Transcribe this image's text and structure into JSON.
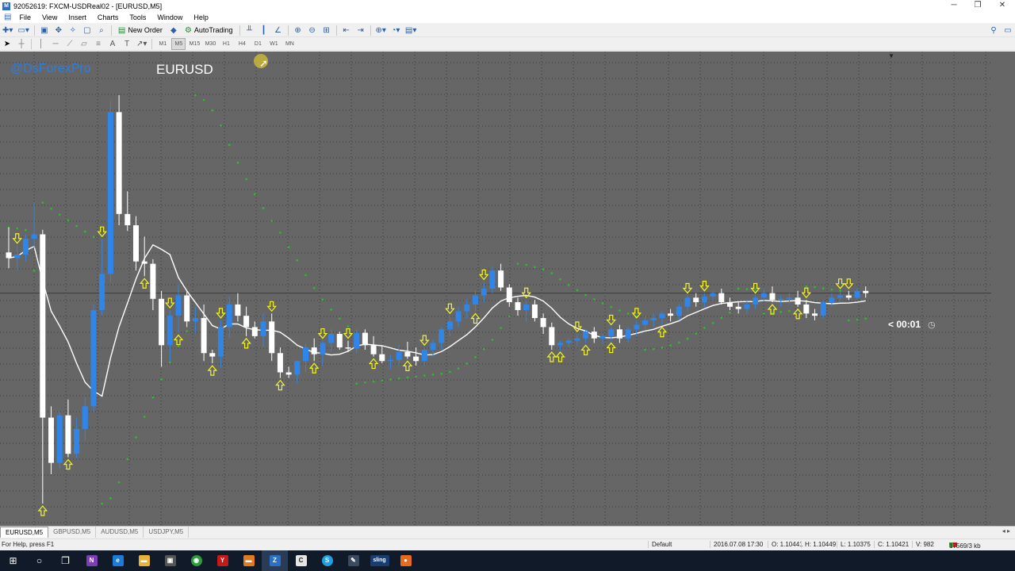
{
  "window": {
    "title": "92052619: FXCM-USDReal02 - [EURUSD,M5]",
    "controls": [
      "─",
      "❐",
      "✕"
    ]
  },
  "menu": [
    "File",
    "View",
    "Insert",
    "Charts",
    "Tools",
    "Window",
    "Help"
  ],
  "toolbar": {
    "new_order": "New Order",
    "autotrading": "AutoTrading"
  },
  "timeframes": [
    "M1",
    "M5",
    "M15",
    "M30",
    "H1",
    "H4",
    "D1",
    "W1",
    "MN"
  ],
  "chart": {
    "watermark": "@DsForexPro",
    "symbol_label": "EURUSD",
    "timer": "< 00:01",
    "bull_color": "#2f86e8",
    "bear_color": "#ffffff",
    "arrow_color": "#f5f51e",
    "sar_color": "#27c227",
    "ma_color": "#ffffff",
    "background": "#666666"
  },
  "chart_data": {
    "type": "candlestick",
    "symbol": "EURUSD",
    "timeframe": "M5",
    "candles": [
      {
        "o": 1.10446,
        "h": 1.10468,
        "l": 1.10432,
        "c": 1.10441
      },
      {
        "o": 1.10441,
        "h": 1.10452,
        "l": 1.1043,
        "c": 1.10444
      },
      {
        "o": 1.10444,
        "h": 1.10462,
        "l": 1.10438,
        "c": 1.10458
      },
      {
        "o": 1.10458,
        "h": 1.1049,
        "l": 1.1045,
        "c": 1.10462
      },
      {
        "o": 1.10462,
        "h": 1.10466,
        "l": 1.10224,
        "c": 1.103
      },
      {
        "o": 1.103,
        "h": 1.1031,
        "l": 1.1025,
        "c": 1.1026
      },
      {
        "o": 1.1026,
        "h": 1.10305,
        "l": 1.10255,
        "c": 1.10302
      },
      {
        "o": 1.10302,
        "h": 1.10316,
        "l": 1.10265,
        "c": 1.10268
      },
      {
        "o": 1.10268,
        "h": 1.103,
        "l": 1.10264,
        "c": 1.1029
      },
      {
        "o": 1.1029,
        "h": 1.10318,
        "l": 1.1028,
        "c": 1.1031
      },
      {
        "o": 1.1031,
        "h": 1.104,
        "l": 1.10305,
        "c": 1.10395
      },
      {
        "o": 1.10395,
        "h": 1.10458,
        "l": 1.1039,
        "c": 1.10427
      },
      {
        "o": 1.10427,
        "h": 1.1058,
        "l": 1.1042,
        "c": 1.1057
      },
      {
        "o": 1.1057,
        "h": 1.10585,
        "l": 1.1047,
        "c": 1.1048
      },
      {
        "o": 1.1048,
        "h": 1.105,
        "l": 1.10465,
        "c": 1.1047
      },
      {
        "o": 1.1047,
        "h": 1.10478,
        "l": 1.1043,
        "c": 1.10438
      },
      {
        "o": 1.10438,
        "h": 1.1046,
        "l": 1.10425,
        "c": 1.10436
      },
      {
        "o": 1.10436,
        "h": 1.1044,
        "l": 1.10395,
        "c": 1.10405
      },
      {
        "o": 1.10405,
        "h": 1.10412,
        "l": 1.10345,
        "c": 1.10364
      },
      {
        "o": 1.10364,
        "h": 1.10395,
        "l": 1.1035,
        "c": 1.1039
      },
      {
        "o": 1.1039,
        "h": 1.10418,
        "l": 1.10375,
        "c": 1.10408
      },
      {
        "o": 1.10408,
        "h": 1.10412,
        "l": 1.1038,
        "c": 1.10385
      },
      {
        "o": 1.10385,
        "h": 1.10398,
        "l": 1.10375,
        "c": 1.10388
      },
      {
        "o": 1.10388,
        "h": 1.104,
        "l": 1.1035,
        "c": 1.10357
      },
      {
        "o": 1.10357,
        "h": 1.1036,
        "l": 1.10348,
        "c": 1.10354
      },
      {
        "o": 1.10354,
        "h": 1.10386,
        "l": 1.10344,
        "c": 1.1038
      },
      {
        "o": 1.1038,
        "h": 1.10407,
        "l": 1.1037,
        "c": 1.104
      },
      {
        "o": 1.104,
        "h": 1.1041,
        "l": 1.10385,
        "c": 1.1039
      },
      {
        "o": 1.1039,
        "h": 1.10398,
        "l": 1.10372,
        "c": 1.1038
      },
      {
        "o": 1.1038,
        "h": 1.10385,
        "l": 1.1037,
        "c": 1.10372
      },
      {
        "o": 1.10372,
        "h": 1.10392,
        "l": 1.10362,
        "c": 1.10385
      },
      {
        "o": 1.10385,
        "h": 1.10392,
        "l": 1.1035,
        "c": 1.10357
      },
      {
        "o": 1.10357,
        "h": 1.10362,
        "l": 1.10335,
        "c": 1.1034
      },
      {
        "o": 1.1034,
        "h": 1.10345,
        "l": 1.10335,
        "c": 1.10338
      },
      {
        "o": 1.10338,
        "h": 1.1035,
        "l": 1.1033,
        "c": 1.1035
      },
      {
        "o": 1.1035,
        "h": 1.10365,
        "l": 1.1034,
        "c": 1.10362
      },
      {
        "o": 1.10362,
        "h": 1.1037,
        "l": 1.1035,
        "c": 1.10356
      },
      {
        "o": 1.10356,
        "h": 1.10368,
        "l": 1.10346,
        "c": 1.10366
      },
      {
        "o": 1.10366,
        "h": 1.10378,
        "l": 1.10358,
        "c": 1.10374
      },
      {
        "o": 1.10374,
        "h": 1.10376,
        "l": 1.1036,
        "c": 1.10362
      },
      {
        "o": 1.10362,
        "h": 1.10368,
        "l": 1.10358,
        "c": 1.10361
      },
      {
        "o": 1.10361,
        "h": 1.10378,
        "l": 1.10357,
        "c": 1.10375
      },
      {
        "o": 1.10375,
        "h": 1.10378,
        "l": 1.1036,
        "c": 1.10364
      },
      {
        "o": 1.10364,
        "h": 1.10372,
        "l": 1.10354,
        "c": 1.10356
      },
      {
        "o": 1.10356,
        "h": 1.10363,
        "l": 1.10348,
        "c": 1.1035
      },
      {
        "o": 1.1035,
        "h": 1.10356,
        "l": 1.10343,
        "c": 1.10351
      },
      {
        "o": 1.10351,
        "h": 1.10364,
        "l": 1.10346,
        "c": 1.10358
      },
      {
        "o": 1.10358,
        "h": 1.10367,
        "l": 1.10352,
        "c": 1.10354
      },
      {
        "o": 1.10354,
        "h": 1.10362,
        "l": 1.10346,
        "c": 1.1035
      },
      {
        "o": 1.1035,
        "h": 1.10362,
        "l": 1.10346,
        "c": 1.1036
      },
      {
        "o": 1.1036,
        "h": 1.10369,
        "l": 1.10354,
        "c": 1.10366
      },
      {
        "o": 1.10366,
        "h": 1.1038,
        "l": 1.1036,
        "c": 1.10378
      },
      {
        "o": 1.10378,
        "h": 1.1039,
        "l": 1.10372,
        "c": 1.10385
      },
      {
        "o": 1.10385,
        "h": 1.10398,
        "l": 1.1038,
        "c": 1.10394
      },
      {
        "o": 1.10394,
        "h": 1.10405,
        "l": 1.10388,
        "c": 1.104
      },
      {
        "o": 1.104,
        "h": 1.10412,
        "l": 1.10394,
        "c": 1.10408
      },
      {
        "o": 1.10408,
        "h": 1.1042,
        "l": 1.10402,
        "c": 1.10414
      },
      {
        "o": 1.10414,
        "h": 1.10434,
        "l": 1.1041,
        "c": 1.1043
      },
      {
        "o": 1.1043,
        "h": 1.10436,
        "l": 1.10412,
        "c": 1.10415
      },
      {
        "o": 1.10415,
        "h": 1.10418,
        "l": 1.10398,
        "c": 1.10402
      },
      {
        "o": 1.10402,
        "h": 1.10406,
        "l": 1.1039,
        "c": 1.10395
      },
      {
        "o": 1.10395,
        "h": 1.10404,
        "l": 1.10384,
        "c": 1.104
      },
      {
        "o": 1.104,
        "h": 1.10404,
        "l": 1.10385,
        "c": 1.10388
      },
      {
        "o": 1.10388,
        "h": 1.10392,
        "l": 1.10374,
        "c": 1.1038
      },
      {
        "o": 1.1038,
        "h": 1.10384,
        "l": 1.1036,
        "c": 1.10364
      },
      {
        "o": 1.10364,
        "h": 1.10368,
        "l": 1.1036,
        "c": 1.10366
      },
      {
        "o": 1.10366,
        "h": 1.1037,
        "l": 1.10362,
        "c": 1.10368
      },
      {
        "o": 1.10368,
        "h": 1.10374,
        "l": 1.10363,
        "c": 1.1037
      },
      {
        "o": 1.1037,
        "h": 1.10378,
        "l": 1.10366,
        "c": 1.10376
      },
      {
        "o": 1.10376,
        "h": 1.1038,
        "l": 1.10366,
        "c": 1.1037
      },
      {
        "o": 1.1037,
        "h": 1.10374,
        "l": 1.10365,
        "c": 1.10372
      },
      {
        "o": 1.10372,
        "h": 1.1038,
        "l": 1.10368,
        "c": 1.10378
      },
      {
        "o": 1.10378,
        "h": 1.10382,
        "l": 1.10366,
        "c": 1.1037
      },
      {
        "o": 1.1037,
        "h": 1.1038,
        "l": 1.10366,
        "c": 1.10378
      },
      {
        "o": 1.10378,
        "h": 1.10386,
        "l": 1.10372,
        "c": 1.10382
      },
      {
        "o": 1.10382,
        "h": 1.1039,
        "l": 1.10378,
        "c": 1.10386
      },
      {
        "o": 1.10386,
        "h": 1.10392,
        "l": 1.1038,
        "c": 1.10388
      },
      {
        "o": 1.10388,
        "h": 1.10394,
        "l": 1.10382,
        "c": 1.10392
      },
      {
        "o": 1.10392,
        "h": 1.10396,
        "l": 1.10385,
        "c": 1.1039
      },
      {
        "o": 1.1039,
        "h": 1.104,
        "l": 1.10386,
        "c": 1.10398
      },
      {
        "o": 1.10398,
        "h": 1.10408,
        "l": 1.10394,
        "c": 1.10406
      },
      {
        "o": 1.10406,
        "h": 1.1041,
        "l": 1.10398,
        "c": 1.10402
      },
      {
        "o": 1.10402,
        "h": 1.1041,
        "l": 1.10398,
        "c": 1.10407
      },
      {
        "o": 1.10407,
        "h": 1.10412,
        "l": 1.10403,
        "c": 1.1041
      },
      {
        "o": 1.1041,
        "h": 1.10414,
        "l": 1.104,
        "c": 1.10402
      },
      {
        "o": 1.10402,
        "h": 1.10406,
        "l": 1.10395,
        "c": 1.10398
      },
      {
        "o": 1.10398,
        "h": 1.10402,
        "l": 1.10392,
        "c": 1.10396
      },
      {
        "o": 1.10396,
        "h": 1.10404,
        "l": 1.10392,
        "c": 1.104
      },
      {
        "o": 1.104,
        "h": 1.10408,
        "l": 1.10396,
        "c": 1.10406
      },
      {
        "o": 1.10406,
        "h": 1.10414,
        "l": 1.10402,
        "c": 1.1041
      },
      {
        "o": 1.1041,
        "h": 1.10416,
        "l": 1.10402,
        "c": 1.10404
      },
      {
        "o": 1.10404,
        "h": 1.10408,
        "l": 1.10398,
        "c": 1.10405
      },
      {
        "o": 1.10405,
        "h": 1.1041,
        "l": 1.104,
        "c": 1.10406
      },
      {
        "o": 1.10406,
        "h": 1.10412,
        "l": 1.10398,
        "c": 1.104
      },
      {
        "o": 1.104,
        "h": 1.10404,
        "l": 1.10388,
        "c": 1.10392
      },
      {
        "o": 1.10392,
        "h": 1.10396,
        "l": 1.10386,
        "c": 1.1039
      },
      {
        "o": 1.1039,
        "h": 1.10404,
        "l": 1.10388,
        "c": 1.10402
      },
      {
        "o": 1.10402,
        "h": 1.1041,
        "l": 1.10398,
        "c": 1.10406
      },
      {
        "o": 1.10406,
        "h": 1.10412,
        "l": 1.10402,
        "c": 1.10408
      },
      {
        "o": 1.10408,
        "h": 1.10412,
        "l": 1.10404,
        "c": 1.10406
      },
      {
        "o": 1.10406,
        "h": 1.10414,
        "l": 1.10404,
        "c": 1.10412
      },
      {
        "o": 1.10412,
        "h": 1.10416,
        "l": 1.10406,
        "c": 1.1041
      }
    ],
    "down_arrows": [
      1,
      11,
      19,
      25,
      31,
      37,
      40,
      49,
      52,
      56,
      61,
      67,
      71,
      74,
      80,
      82,
      88,
      94,
      98,
      99
    ],
    "up_arrows": [
      4,
      7,
      16,
      20,
      24,
      28,
      32,
      36,
      43,
      47,
      55,
      64,
      65,
      68,
      71,
      77,
      90,
      93
    ],
    "ylim": [
      1.10224,
      1.10585
    ]
  },
  "tabs": [
    "EURUSD,M5",
    "GBPUSD,M5",
    "AUDUSD,M5",
    "USDJPY,M5"
  ],
  "tab_nav": "◂ ▸",
  "status": {
    "help": "For Help, press F1",
    "profile": "Default",
    "datetime": "2016.07.08 17:30",
    "open": "O: 1.10441",
    "high": "H: 1.10449",
    "low": "L: 1.10375",
    "close": "C: 1.10421",
    "volume": "V: 982",
    "traffic": "17569/3 kb"
  },
  "taskbar": {
    "start": "⊞",
    "search": "○",
    "taskview": "❐",
    "onenote": "N",
    "edge": "e",
    "explorer": "▬",
    "store": "▣",
    "chrome": "◉",
    "yelp": "Y",
    "folder2": "▬",
    "metatrader": "Z",
    "camtasia": "C",
    "skype": "S",
    "tool": "✎",
    "sling": "sling",
    "recorder": "●"
  }
}
